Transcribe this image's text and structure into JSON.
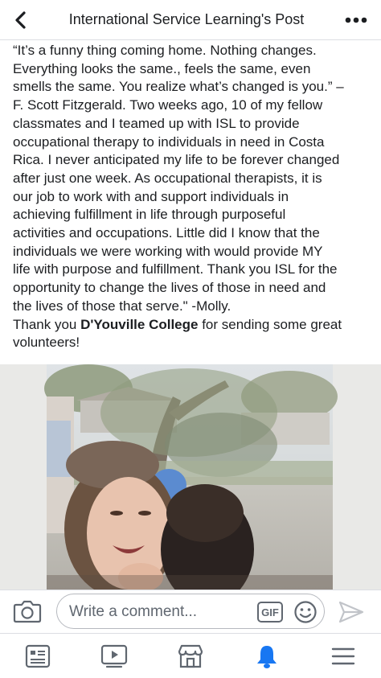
{
  "header": {
    "title": "International Service Learning's Post",
    "back_icon": "chevron-left-icon",
    "more_icon": "more-horizontal-icon"
  },
  "post": {
    "lines": [
      "“It’s a funny thing coming home. Nothing changes.",
      "Everything looks the same., feels the same, even",
      "smells the same. You realize what’s changed is you.” –",
      "F. Scott Fitzgerald. Two weeks ago, 10 of my fellow",
      "classmates and I teamed up with ISL to provide",
      "occupational therapy to individuals in need in Costa",
      "Rica. I never anticipated my life to be forever changed",
      "after just one week. As occupational therapists, it is",
      "our job to work with and support individuals in",
      "achieving fulfillment in life through purposeful",
      "activities and occupations. Little did I know that the",
      "individuals we were working with would provide MY",
      "life with purpose and fulfillment. Thank you ISL for the",
      "opportunity to change the lives of those in need and",
      "the lives of those that serve.\" -Molly."
    ],
    "thanks_prefix": "Thank you ",
    "thanks_link": "D'Youville College",
    "thanks_suffix": " for sending some great",
    "thanks_end": "volunteers!"
  },
  "comment_bar": {
    "placeholder": "Write a comment...",
    "gif_label": "GIF",
    "camera_icon": "camera-icon",
    "emoji_icon": "emoji-icon",
    "send_icon": "send-icon"
  },
  "nav": {
    "items": [
      "news-feed-icon",
      "watch-icon",
      "marketplace-icon",
      "notifications-icon",
      "menu-icon"
    ],
    "active": "notifications-icon",
    "active_color": "#1877f2",
    "inactive_color": "#606770"
  }
}
